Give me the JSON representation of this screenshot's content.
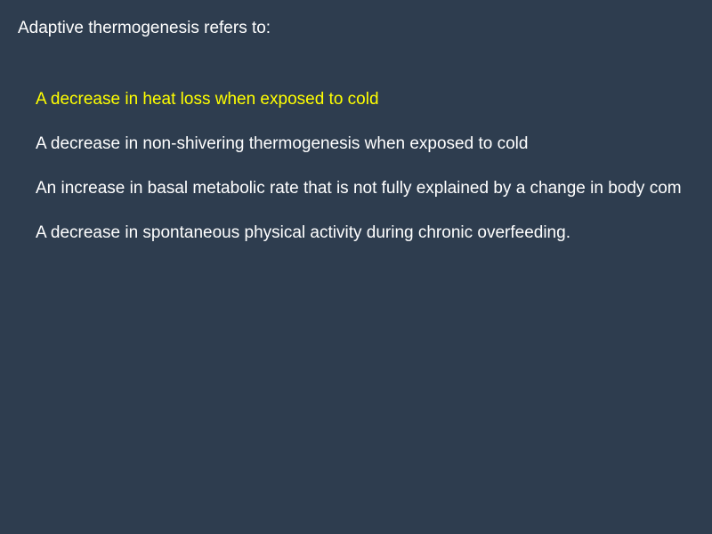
{
  "question": {
    "text": "Adaptive thermogenesis refers to:"
  },
  "options": [
    {
      "text": "A decrease in heat loss when exposed to cold",
      "highlighted": true
    },
    {
      "text": "A decrease in non-shivering thermogenesis when exposed to cold",
      "highlighted": false
    },
    {
      "text": "An increase in basal metabolic rate that is not fully explained by a change in body com",
      "highlighted": false
    },
    {
      "text": "A decrease in spontaneous physical activity during chronic overfeeding.",
      "highlighted": false
    }
  ],
  "colors": {
    "background": "#2e3d4f",
    "text": "#ffffff",
    "highlight": "#ffff00"
  }
}
